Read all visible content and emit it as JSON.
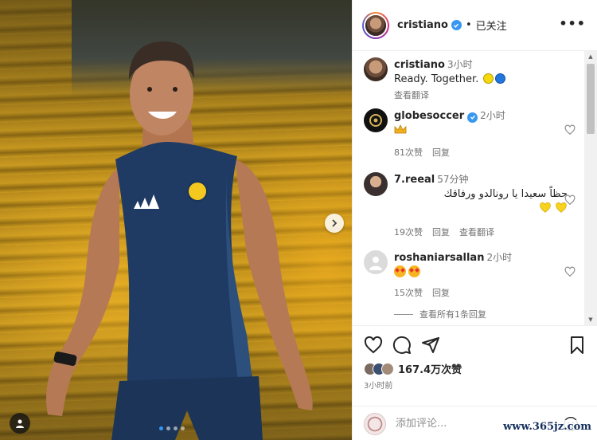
{
  "post": {
    "username": "cristiano",
    "separator": "•",
    "follow_status": "已关注",
    "more_label": "•••",
    "carousel": {
      "slide_count": 4,
      "active_slide": 1
    }
  },
  "colors": {
    "verified": "#3897f0",
    "meta_gray": "#737373",
    "active_dot": "#3897f0"
  },
  "comments": [
    {
      "user": "cristiano",
      "time": "3小时",
      "text": "Ready. Together.",
      "emojis": [
        "yellow-circle",
        "blue-circle"
      ],
      "translate": "查看翻译"
    },
    {
      "user": "globesoccer",
      "time": "2小时",
      "text": "",
      "emojis": [
        "crown"
      ],
      "likes": "81次赞",
      "reply": "回复"
    },
    {
      "user": "7.reeal",
      "time": "57分钟",
      "text": "حظاً سعيدا يا رونالدو ورفاقك",
      "emojis": [
        "yellow-heart",
        "yellow-heart"
      ],
      "likes": "19次赞",
      "reply": "回复",
      "translate": "查看翻译"
    },
    {
      "user": "roshaniarsallan",
      "time": "2小时",
      "text": "",
      "emojis": [
        "star-struck",
        "star-struck"
      ],
      "likes": "15次赞",
      "reply": "回复"
    }
  ],
  "view_replies": "查看所有1条回复",
  "likes_total": "167.4万次赞",
  "posted_ago": "3小时前",
  "comment_input": {
    "placeholder": "添加评论..."
  },
  "watermark": "www.365jz.com"
}
